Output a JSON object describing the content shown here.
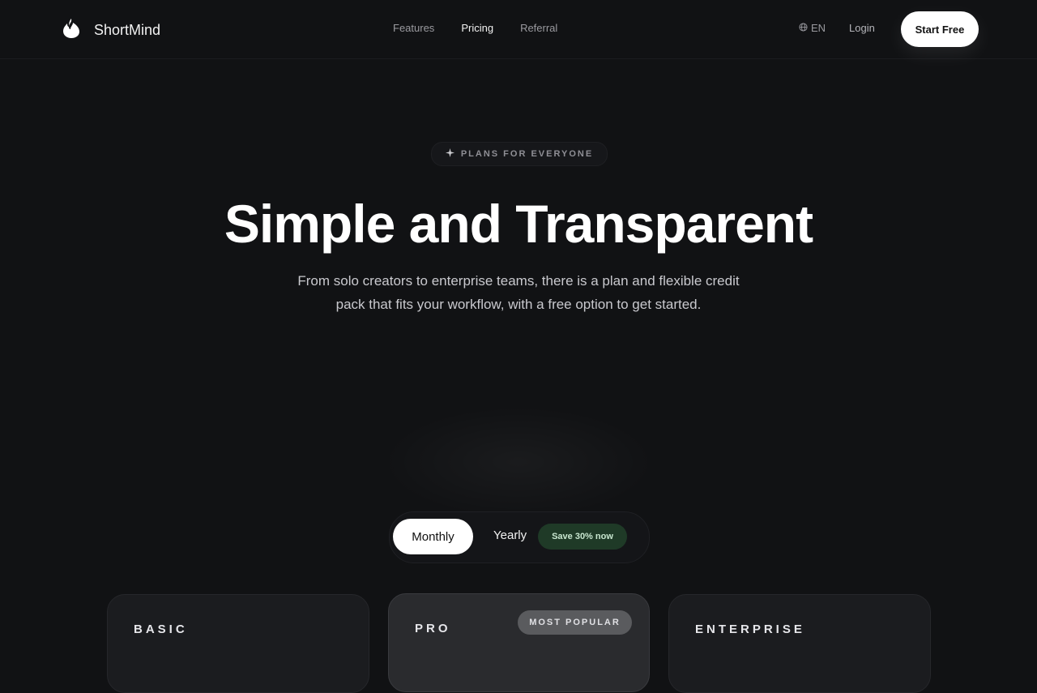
{
  "nav": {
    "brand": "ShortMind",
    "links": [
      {
        "label": "Features"
      },
      {
        "label": "Pricing"
      },
      {
        "label": "Referral"
      }
    ],
    "lang": "EN",
    "login": "Login",
    "cta": "Start Free"
  },
  "hero": {
    "badge": "PLANS FOR EVERYONE",
    "title": "Simple and Transparent",
    "subtitle_line1": "From solo creators to enterprise teams, there is a plan and flexible credit",
    "subtitle_line2": "pack that fits your workflow, with a free option to get started."
  },
  "billing": {
    "monthly": "Monthly",
    "yearly": "Yearly",
    "save": "Save 30% now"
  },
  "plans": [
    {
      "name": "BASIC"
    },
    {
      "name": "PRO",
      "badge": "MOST POPULAR"
    },
    {
      "name": "ENTERPRISE"
    }
  ]
}
